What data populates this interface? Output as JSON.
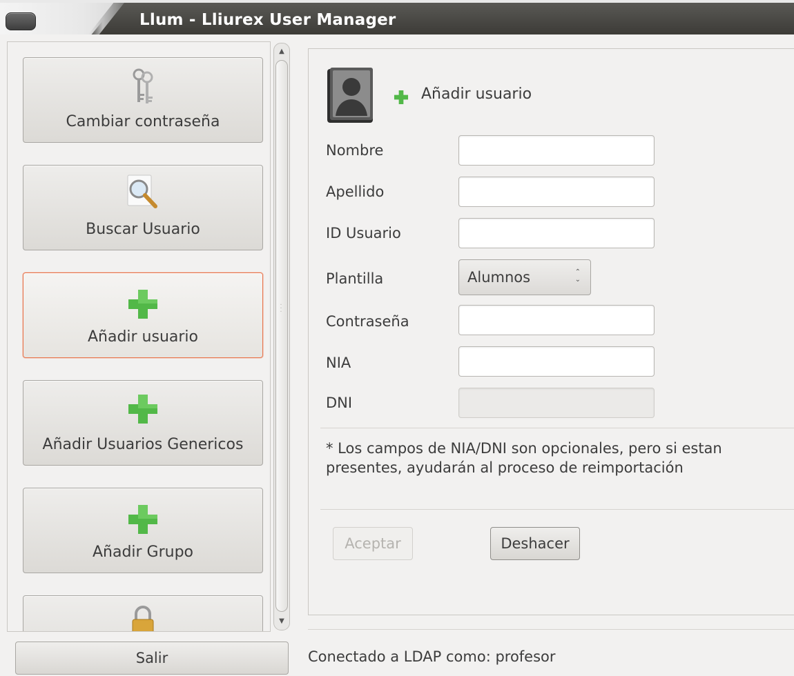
{
  "window": {
    "title": "Llum - Lliurex User Manager"
  },
  "sidebar": {
    "items": [
      {
        "label": "Cambiar contraseña",
        "icon": "keys-icon"
      },
      {
        "label": "Buscar Usuario",
        "icon": "search-icon"
      },
      {
        "label": "Añadir usuario",
        "icon": "add-icon",
        "active": true
      },
      {
        "label": "Añadir Usuarios Genericos",
        "icon": "add-icon"
      },
      {
        "label": "Añadir Grupo",
        "icon": "add-icon"
      },
      {
        "label": "",
        "icon": "lock-icon"
      }
    ],
    "exit_label": "Salir"
  },
  "form": {
    "title": "Añadir usuario",
    "fields": {
      "nombre": {
        "label": "Nombre",
        "value": ""
      },
      "apellido": {
        "label": "Apellido",
        "value": ""
      },
      "id_usuario": {
        "label": "ID Usuario",
        "value": ""
      },
      "plantilla": {
        "label": "Plantilla",
        "value": "Alumnos"
      },
      "contrasena": {
        "label": "Contraseña",
        "value": ""
      },
      "nia": {
        "label": "NIA",
        "value": ""
      },
      "dni": {
        "label": "DNI",
        "value": ""
      }
    },
    "note": "* Los campos de NIA/DNI son opcionales, pero si estan presentes, ayudarán al proceso de reimportación",
    "accept_label": "Aceptar",
    "undo_label": "Deshacer"
  },
  "status": {
    "text": "Conectado a LDAP como: profesor"
  },
  "colors": {
    "active_border": "#e8734a",
    "plus_green": "#4caf50",
    "titlebar": "#3c3b37"
  }
}
